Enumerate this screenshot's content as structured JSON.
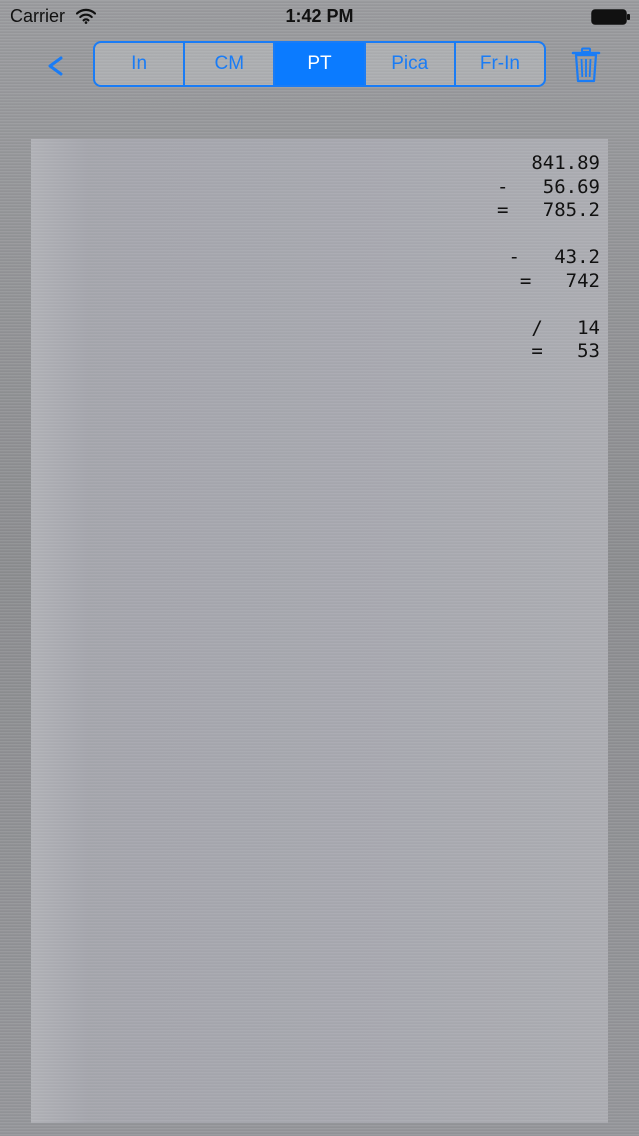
{
  "status_bar": {
    "carrier": "Carrier",
    "time": "1:42 PM"
  },
  "nav": {
    "back_label": "<",
    "units": [
      {
        "label": "In",
        "selected": false
      },
      {
        "label": "CM",
        "selected": false
      },
      {
        "label": "PT",
        "selected": true
      },
      {
        "label": "Pica",
        "selected": false
      },
      {
        "label": "Fr-In",
        "selected": false
      }
    ],
    "trash_icon": "trash-icon"
  },
  "tape": {
    "lines": [
      "841.89",
      "-   56.69",
      "=   785.2",
      "",
      "-   43.2",
      "=   742",
      "",
      "/   14",
      "=   53"
    ]
  },
  "colors": {
    "accent": "#1a7cf5",
    "selected_segment": "#0b7bff",
    "tape_background": "#a9aab1",
    "metal_background": "#8f9093"
  }
}
